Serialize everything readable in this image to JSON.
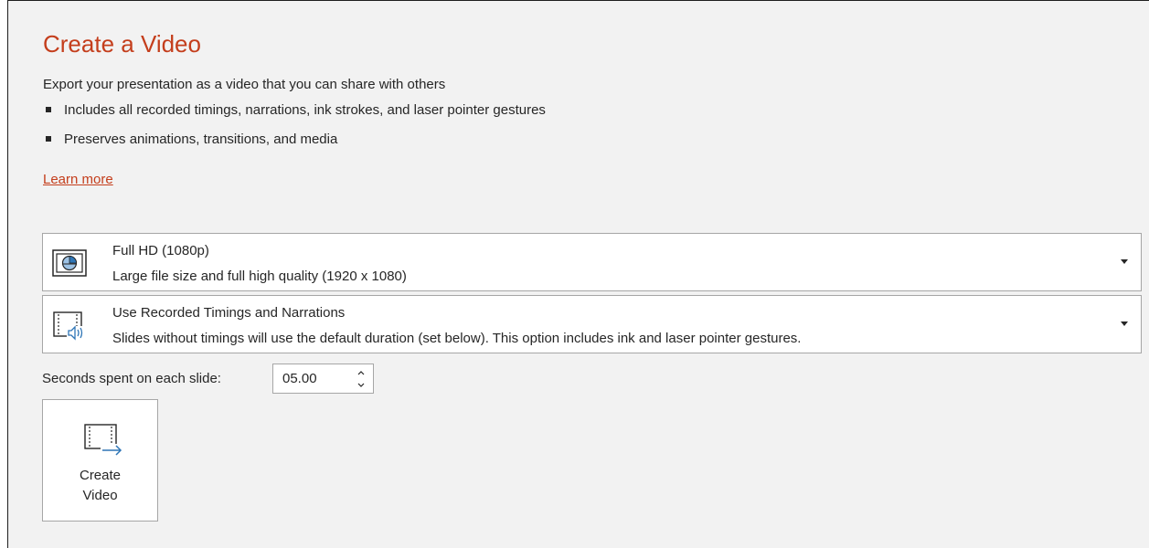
{
  "panel": {
    "title": "Create a Video",
    "description": "Export your presentation as a video that you can share with others",
    "bullets": [
      "Includes all recorded timings, narrations, ink strokes, and laser pointer gestures",
      "Preserves animations, transitions, and media"
    ],
    "learn_more": "Learn more"
  },
  "quality_dropdown": {
    "selected": "Full HD (1080p)",
    "detail": "Large file size and full high quality (1920 x 1080)",
    "icon": "monitor-icon"
  },
  "timings_dropdown": {
    "selected": "Use Recorded Timings and Narrations",
    "detail": "Slides without timings will use the default duration (set below). This option includes ink and laser pointer gestures.",
    "icon": "slide-narration-icon"
  },
  "seconds": {
    "label": "Seconds spent on each slide:",
    "value": "05.00"
  },
  "create_button": {
    "label": "Create\nVideo",
    "icon": "create-video-icon"
  },
  "colors": {
    "accent": "#c43e1c",
    "icon_blue": "#2e75b6",
    "background": "#f2f2f2"
  }
}
